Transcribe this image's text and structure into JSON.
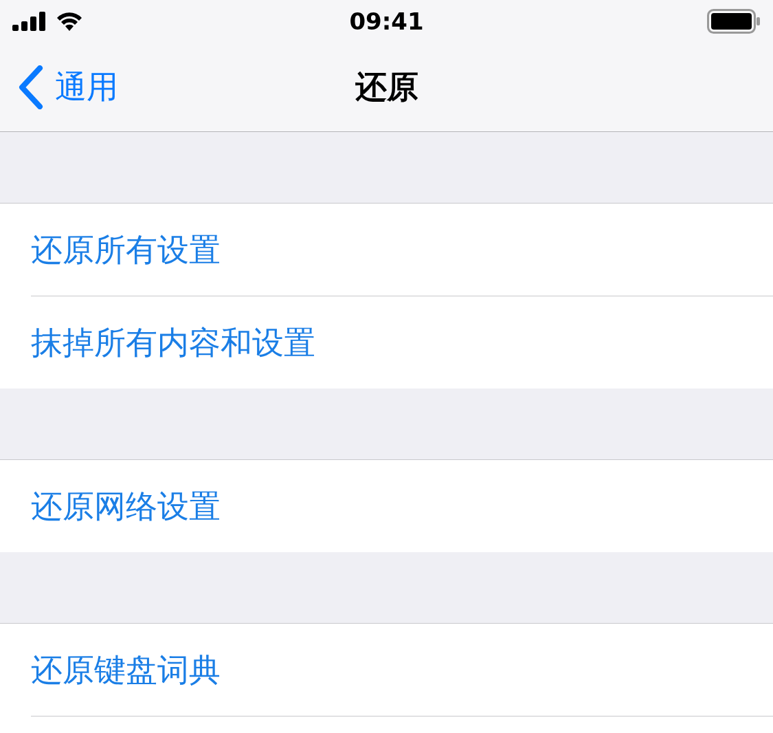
{
  "status_bar": {
    "time": "09:41"
  },
  "nav_bar": {
    "back_label": "通用",
    "title": "还原"
  },
  "sections": [
    {
      "items": [
        {
          "label": "还原所有设置"
        },
        {
          "label": "抹掉所有内容和设置"
        }
      ]
    },
    {
      "items": [
        {
          "label": "还原网络设置"
        }
      ]
    },
    {
      "items": [
        {
          "label": "还原键盘词典"
        }
      ]
    }
  ]
}
